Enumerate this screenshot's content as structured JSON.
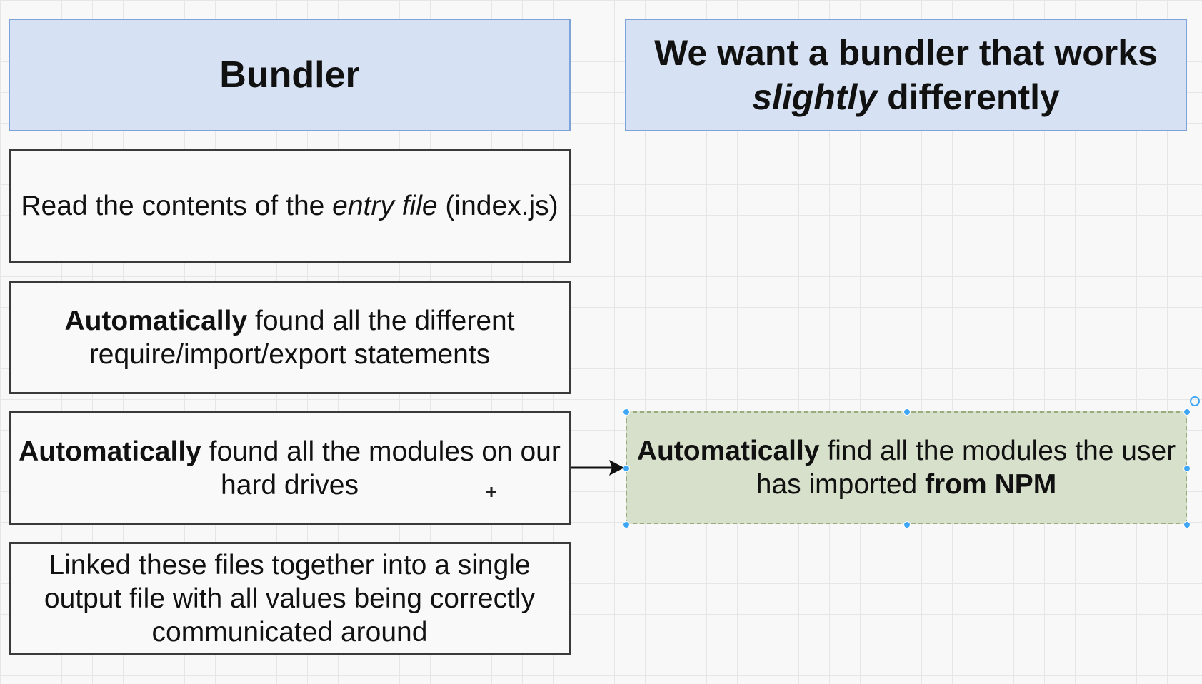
{
  "left_header": {
    "title": "Bundler"
  },
  "right_header": {
    "line1": "We want a bundler that works",
    "line2_em": "slightly",
    "line2_rest": " differently"
  },
  "steps": [
    {
      "pre": "Read the contents of the ",
      "em": "entry file",
      "post": " (index.js)"
    },
    {
      "strong": "Automatically",
      "rest1": " found all the different",
      "line2": "require/import/export statements"
    },
    {
      "strong": "Automatically",
      "rest1": " found all the modules on our",
      "line2": "hard drives"
    },
    {
      "line1": "Linked these files together into a single",
      "line2": "output file with all values being correctly",
      "line3": "communicated around"
    }
  ],
  "target": {
    "strong": "Automatically",
    "rest1": " find all the modules the user",
    "line2_pre": "has imported ",
    "line2_strong": "from NPM"
  },
  "colors": {
    "header_fill": "#d6e2f3",
    "header_border": "#7da3d8",
    "target_fill": "#d7e0cb",
    "selection_handle": "#3fa5f5"
  }
}
